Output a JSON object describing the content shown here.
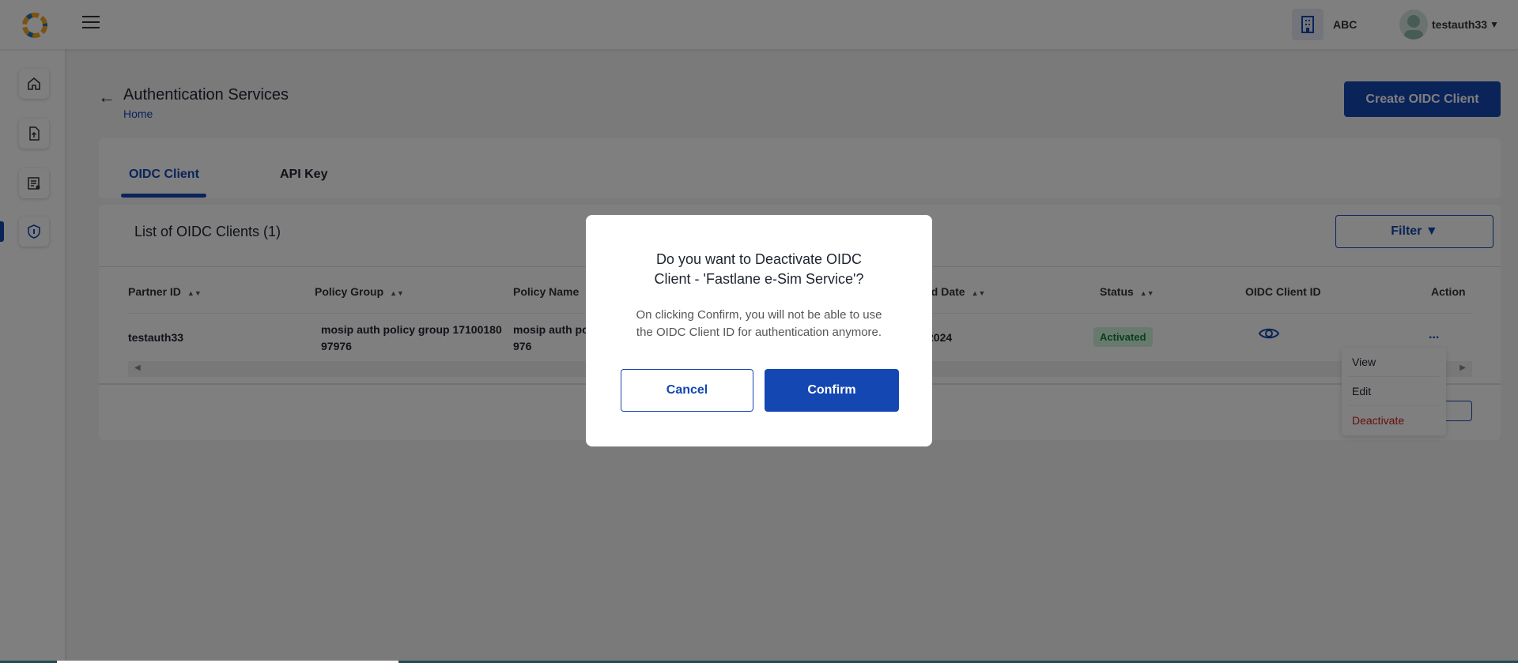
{
  "header": {
    "org_name": "ABC",
    "user_name": "testauth33"
  },
  "page": {
    "title": "Authentication Services",
    "breadcrumb": "Home",
    "create_button": "Create OIDC Client"
  },
  "tabs": [
    {
      "label": "OIDC Client",
      "active": true
    },
    {
      "label": "API Key",
      "active": false
    }
  ],
  "list": {
    "title": "List of OIDC Clients (1)",
    "filter_label": "Filter",
    "columns": [
      "Partner ID",
      "Policy Group",
      "Policy Name",
      "ed Date",
      "Status",
      "OIDC Client ID",
      "Action"
    ],
    "row": {
      "partner_id": "testauth33",
      "policy_group_line1": "mosip auth policy group 17100180",
      "policy_group_line2": "97976",
      "policy_name_line1": "mosip auth po",
      "policy_name_line2": "976",
      "date_fragment": "2024",
      "status": "Activated",
      "action": "..."
    }
  },
  "action_menu": {
    "items": [
      "View",
      "Edit",
      "Deactivate"
    ]
  },
  "modal": {
    "title_line1": "Do you want to Deactivate OIDC",
    "title_line2": "Client - 'Fastlane e-Sim Service'?",
    "message_line1": "On clicking Confirm, you will not be able to use",
    "message_line2": "the OIDC Client ID for authentication anymore.",
    "cancel_label": "Cancel",
    "confirm_label": "Confirm"
  },
  "colors": {
    "primary": "#1447b2",
    "danger": "#c81e1e",
    "status_bg": "#d1f5dc",
    "status_text": "#15803d"
  }
}
